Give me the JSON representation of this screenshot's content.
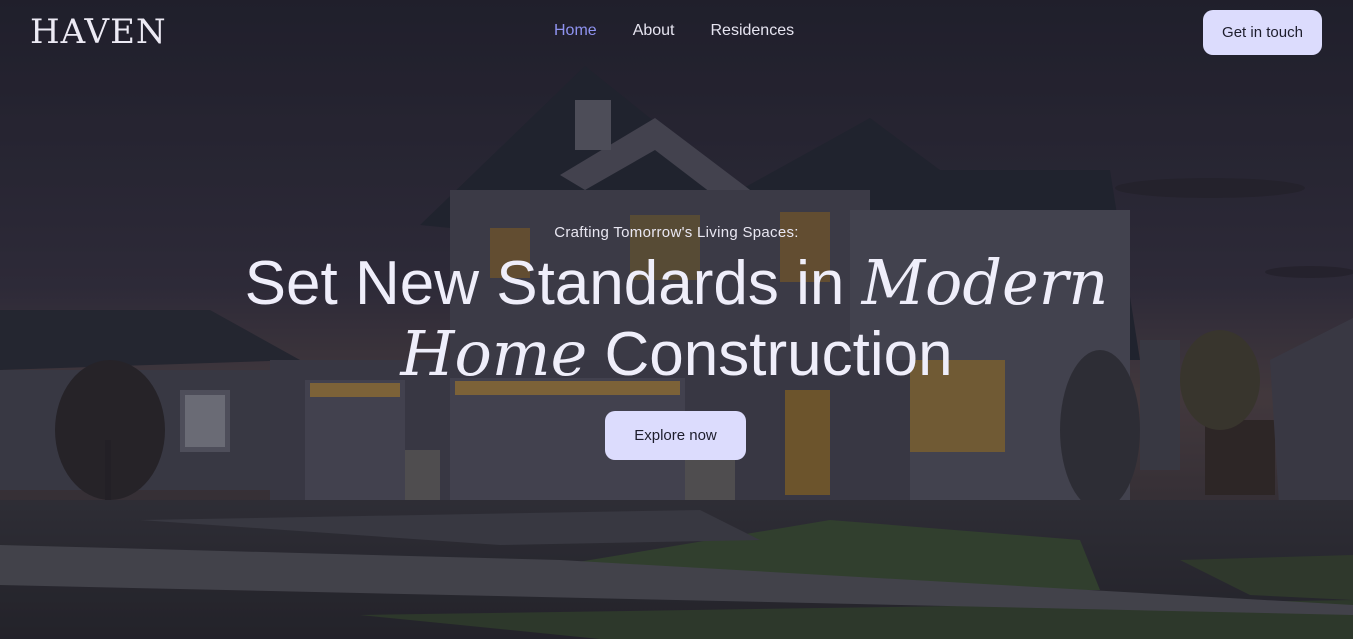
{
  "brand": {
    "logo_text": "HAVEN"
  },
  "nav": {
    "items": [
      {
        "label": "Home",
        "active": true
      },
      {
        "label": "About",
        "active": false
      },
      {
        "label": "Residences",
        "active": false
      }
    ],
    "cta_label": "Get in touch"
  },
  "hero": {
    "tagline": "Crafting Tomorrow's Living Spaces:",
    "headline_part1": "Set New Standards in ",
    "headline_em1": "Modern",
    "headline_em2": "Home",
    "headline_part2": " Construction",
    "button_label": "Explore now",
    "background_image": "house-at-dusk-photo"
  },
  "colors": {
    "accent": "#dcdcfd",
    "nav_active": "#8f93f0",
    "text_light": "#efeefa"
  }
}
